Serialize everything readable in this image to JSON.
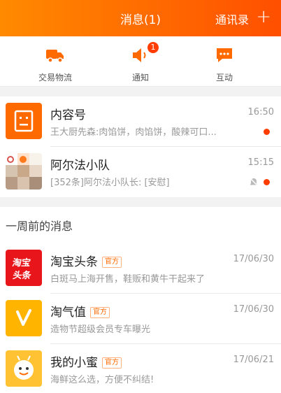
{
  "header": {
    "title": "消息(1)",
    "contacts": "通讯录",
    "plus_icon": "plus-icon",
    "bg_start": "#ff8a00",
    "bg_end": "#ff4f00"
  },
  "quick_actions": [
    {
      "label": "交易物流",
      "icon": "truck-icon"
    },
    {
      "label": "通知",
      "icon": "speaker-icon",
      "badge": "1"
    },
    {
      "label": "互动",
      "icon": "chat-bubble-icon"
    }
  ],
  "conversations": [
    {
      "name": "内容号",
      "time": "16:50",
      "preview": "王大厨先森:肉馅饼，肉馅饼，酸辣可口...",
      "unread": true,
      "muted": false
    },
    {
      "name": "阿尔法小队",
      "time": "15:15",
      "preview": "[352条]阿尔法小队长: [安慰]",
      "unread": true,
      "muted": true
    }
  ],
  "section_title": "一周前的消息",
  "older": [
    {
      "name": "淘宝头条",
      "tag": "官方",
      "time": "17/06/30",
      "preview": "白斑马上海开售，鞋贩和黄牛干起来了",
      "logo_text": "淘宝\n头条"
    },
    {
      "name": "淘气值",
      "tag": "官方",
      "time": "17/06/30",
      "preview": "造物节超级会员专车曝光"
    },
    {
      "name": "我的小蜜",
      "tag": "官方",
      "time": "17/06/21",
      "preview": "海鲜这么选，方便不纠结!"
    }
  ],
  "colors": {
    "accent": "#ff6a00",
    "unread_dot": "#ff3d00"
  }
}
